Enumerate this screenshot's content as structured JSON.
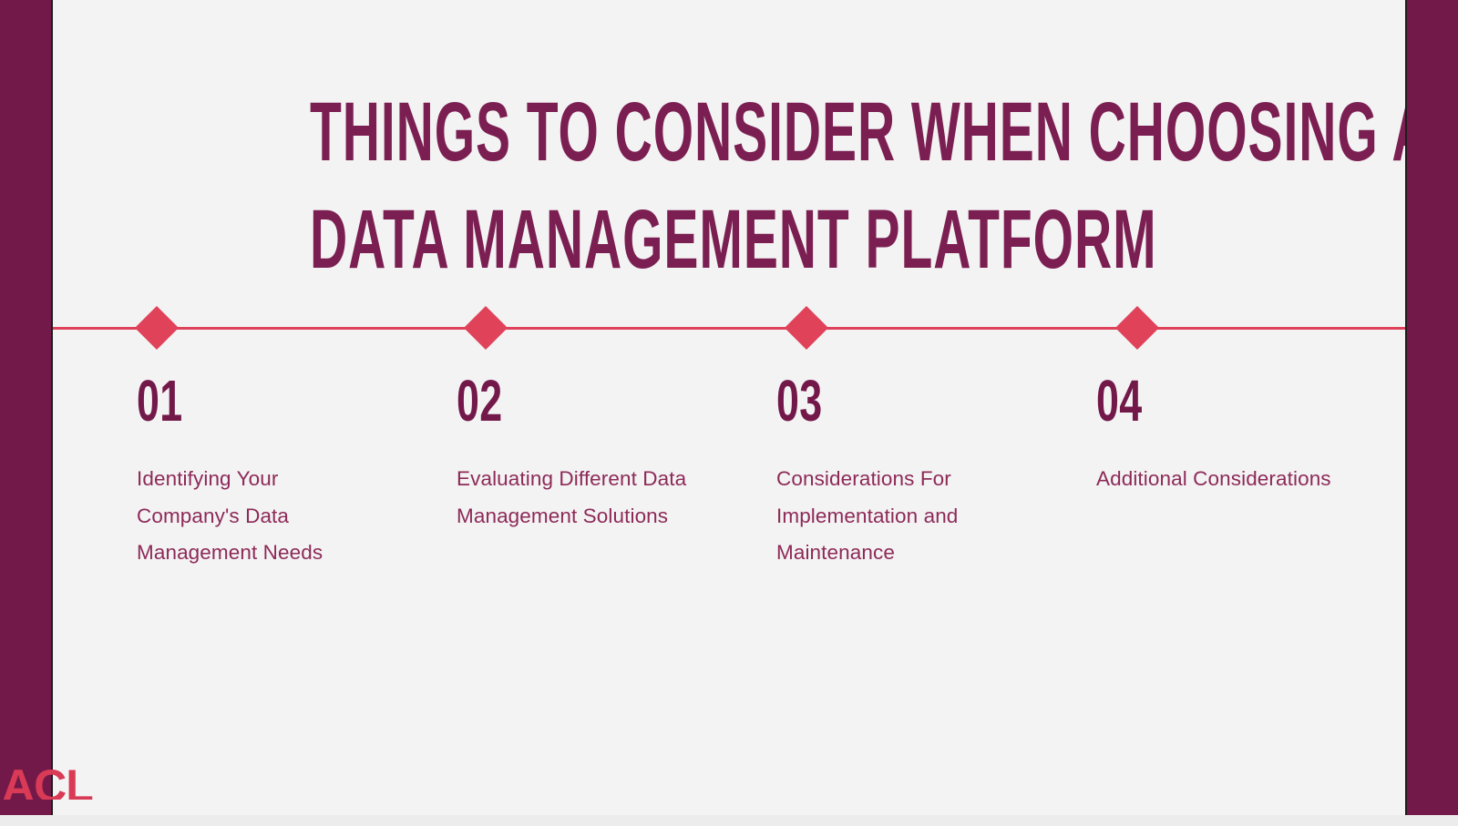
{
  "slide": {
    "background_color": "#f3f3f3",
    "sidebar_color": "#73194a",
    "accent_color": "#e0425a",
    "title_color": "#7b1f52",
    "body_text_color": "#8d2a58",
    "title": {
      "line1": "THINGS TO CONSIDER WHEN CHOOSING A",
      "line2": "DATA MANAGEMENT PLATFORM"
    },
    "items": [
      {
        "number": "01",
        "text": "Identifying Your Company's Data Management Needs"
      },
      {
        "number": "02",
        "text": "Evaluating Different Data Management Solutions"
      },
      {
        "number": "03",
        "text": "Considerations For Implementation and Maintenance"
      },
      {
        "number": "04",
        "text": "Additional Considerations"
      }
    ],
    "logo": {
      "text": "ACL"
    }
  }
}
